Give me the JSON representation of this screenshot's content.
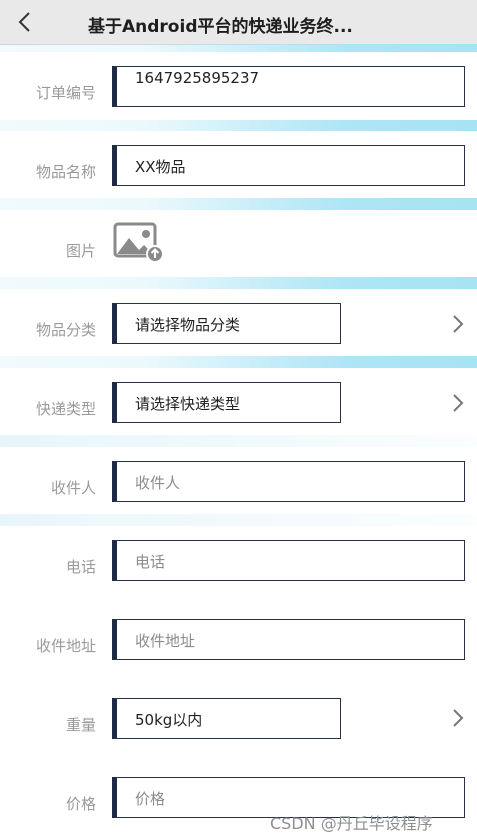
{
  "header": {
    "title": "基于Android平台的快递业务终..."
  },
  "form": {
    "order_no": {
      "label": "订单编号",
      "value": "1647925895237"
    },
    "item_name": {
      "label": "物品名称",
      "value": "XX物品"
    },
    "image": {
      "label": "图片",
      "icon": "image-add-icon"
    },
    "category": {
      "label": "物品分类",
      "value": "请选择物品分类"
    },
    "express": {
      "label": "快递类型",
      "value": "请选择快递类型"
    },
    "receiver": {
      "label": "收件人",
      "placeholder": "收件人"
    },
    "phone": {
      "label": "电话",
      "placeholder": "电话"
    },
    "address": {
      "label": "收件地址",
      "placeholder": "收件地址"
    },
    "weight": {
      "label": "重量",
      "value": "50kg以内"
    },
    "price": {
      "label": "价格",
      "placeholder": "价格"
    }
  },
  "watermark": "CSDN @丹丘毕设程序",
  "colors": {
    "border": "#26314a",
    "separator": "#a6e3f3",
    "label": "#9a9a9a"
  }
}
